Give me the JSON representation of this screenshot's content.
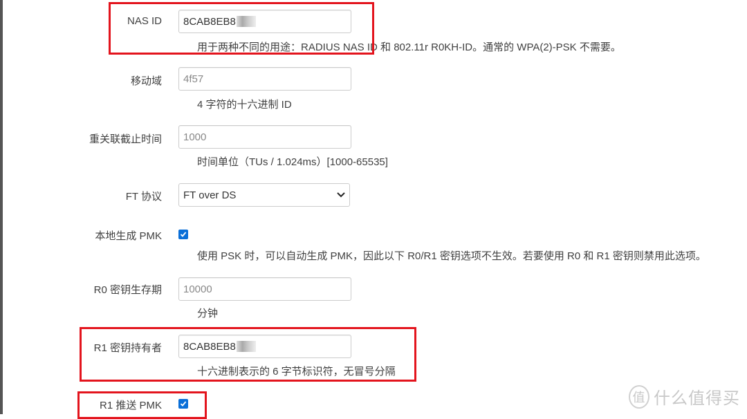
{
  "fields": {
    "nas_id": {
      "label": "NAS ID",
      "value": "8CAB8EB8",
      "help": "用于两种不同的用途：RADIUS NAS ID 和 802.11r R0KH-ID。通常的 WPA(2)-PSK 不需要。"
    },
    "mobility_domain": {
      "label": "移动域",
      "placeholder": "4f57",
      "help": "4 字符的十六进制 ID"
    },
    "reassoc_deadline": {
      "label": "重关联截止时间",
      "placeholder": "1000",
      "help": "时间单位（TUs / 1.024ms）[1000-65535]"
    },
    "ft_protocol": {
      "label": "FT 协议",
      "selected": "FT over DS"
    },
    "local_pmk": {
      "label": "本地生成 PMK",
      "checked": true,
      "help": "使用 PSK 时，可以自动生成 PMK，因此以下 R0/R1 密钥选项不生效。若要使用 R0 和 R1 密钥则禁用此选项。"
    },
    "r0_lifetime": {
      "label": "R0 密钥生存期",
      "placeholder": "10000",
      "help": "分钟"
    },
    "r1_key_holder": {
      "label": "R1 密钥持有者",
      "value": "8CAB8EB8",
      "help": "十六进制表示的 6 字节标识符，无冒号分隔"
    },
    "r1_push_pmk": {
      "label": "R1 推送 PMK",
      "checked": true
    }
  },
  "watermark": {
    "text": "什么值得买",
    "logo": "值"
  },
  "colors": {
    "highlight": "#e3141d",
    "checkbox": "#0a6fd8"
  }
}
